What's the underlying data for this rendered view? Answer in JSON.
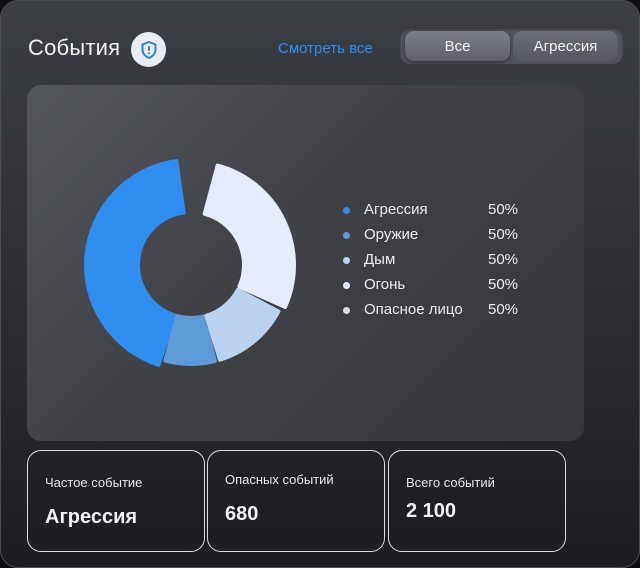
{
  "header": {
    "title": "События",
    "view_all": "Смотреть все",
    "tabs": [
      {
        "label": "Все",
        "active": true
      },
      {
        "label": "Агрессия",
        "active": false
      }
    ]
  },
  "chart_data": {
    "type": "pie",
    "categories": [
      "Агрессия",
      "Оружие",
      "Дым",
      "Огонь",
      "Опасное лицо"
    ],
    "values": [
      50,
      50,
      50,
      50,
      50
    ],
    "value_labels": [
      "50%",
      "50%",
      "50%",
      "50%",
      "50%"
    ],
    "colors": [
      "#2f8ef0",
      "#5e9ad8",
      "#b9d3f0",
      "#e6ecfb",
      "#dcdde0"
    ],
    "legend_position": "right"
  },
  "stats": [
    {
      "label": "Частое событие",
      "value": "Агрессия"
    },
    {
      "label": "Опасных событий",
      "value": "680"
    },
    {
      "label": "Всего событий",
      "value": "2 100"
    }
  ],
  "icons": {
    "badge": "shield-alert-icon"
  }
}
